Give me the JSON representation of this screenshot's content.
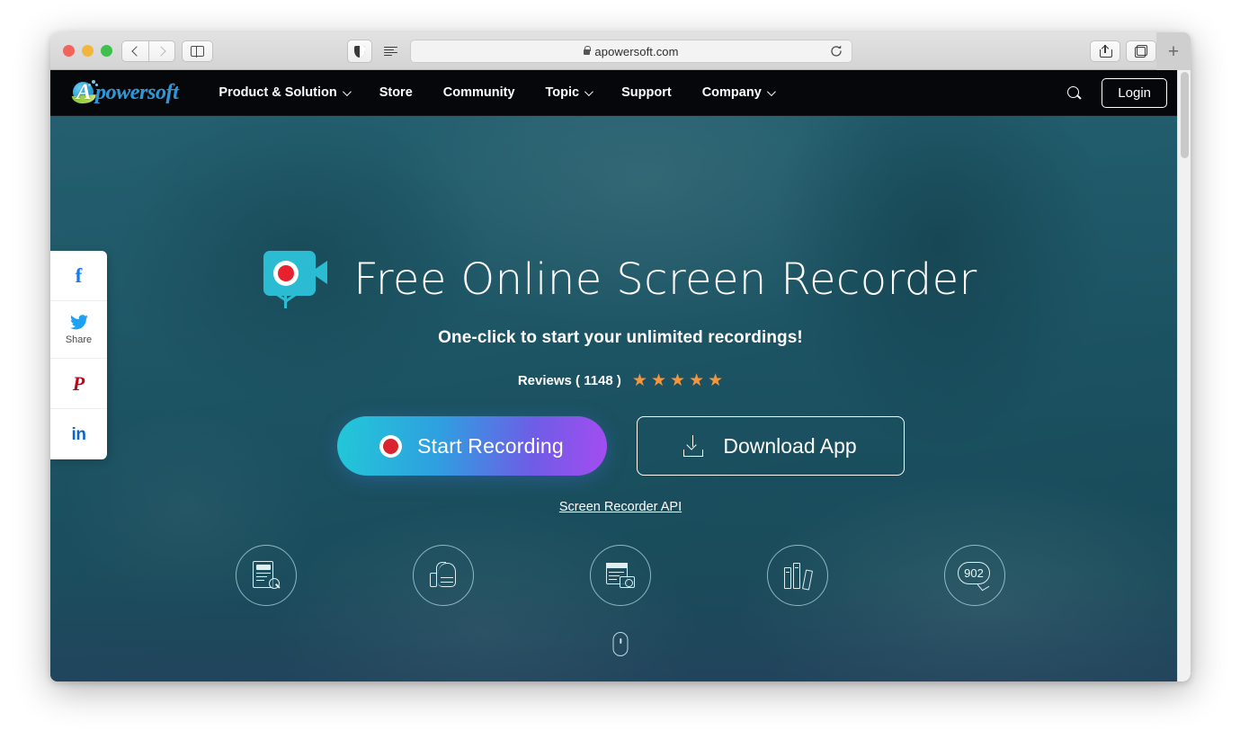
{
  "browser": {
    "url": "apowersoft.com",
    "lock_icon": "lock-icon",
    "back_icon": "chevron-left-icon",
    "forward_icon": "chevron-right-icon",
    "sidebar_icon": "sidebar-toggle-icon",
    "shield_icon": "privacy-shield-icon",
    "reader_icon": "reader-view-icon",
    "reload_icon": "reload-icon",
    "share_icon": "share-icon",
    "tabs_icon": "show-all-tabs-icon",
    "newtab_label": "+",
    "traffic_lights": [
      "close",
      "minimize",
      "zoom"
    ]
  },
  "site_nav": {
    "logo_letter": "A",
    "logo_word": "powersoft",
    "items": [
      {
        "label": "Product & Solution",
        "has_caret": true
      },
      {
        "label": "Store",
        "has_caret": false
      },
      {
        "label": "Community",
        "has_caret": false
      },
      {
        "label": "Topic",
        "has_caret": true
      },
      {
        "label": "Support",
        "has_caret": false
      },
      {
        "label": "Company",
        "has_caret": true
      }
    ],
    "search_icon": "search-icon",
    "login_label": "Login"
  },
  "social_rail": {
    "items": [
      {
        "network": "facebook",
        "glyph": "f",
        "label": ""
      },
      {
        "network": "twitter",
        "glyph": "🐦",
        "label": "Share"
      },
      {
        "network": "pinterest",
        "glyph": "P",
        "label": ""
      },
      {
        "network": "linkedin",
        "glyph": "in",
        "label": ""
      }
    ]
  },
  "hero": {
    "camera_icon": "video-camera-record-icon",
    "title": "Free Online Screen Recorder",
    "subtitle": "One-click to start your unlimited recordings!",
    "reviews_text": "Reviews ( 1148 )",
    "reviews_count": 1148,
    "star_rating": 5,
    "stars": [
      "★",
      "★",
      "★",
      "★",
      "★"
    ],
    "start_recording_label": "Start Recording",
    "download_app_label": "Download App",
    "api_link_label": "Screen Recorder API",
    "scroll_hint_icon": "scroll-down-mouse-icon"
  },
  "feature_icons": [
    {
      "name": "document-search-icon",
      "badge": ""
    },
    {
      "name": "thumbs-up-icon",
      "badge": ""
    },
    {
      "name": "screenshot-camera-icon",
      "badge": ""
    },
    {
      "name": "books-library-icon",
      "badge": ""
    },
    {
      "name": "comments-bubble-icon",
      "badge": "902"
    }
  ],
  "colors": {
    "nav_background": "#05070a",
    "hero_teal": "#1f5566",
    "accent_cyan": "#22c8d8",
    "accent_purple": "#a44cf0",
    "record_red": "#d9232e",
    "star_orange": "#f5953c",
    "logo_blue": "#2e96d4",
    "logo_green": "#8dc63f"
  }
}
